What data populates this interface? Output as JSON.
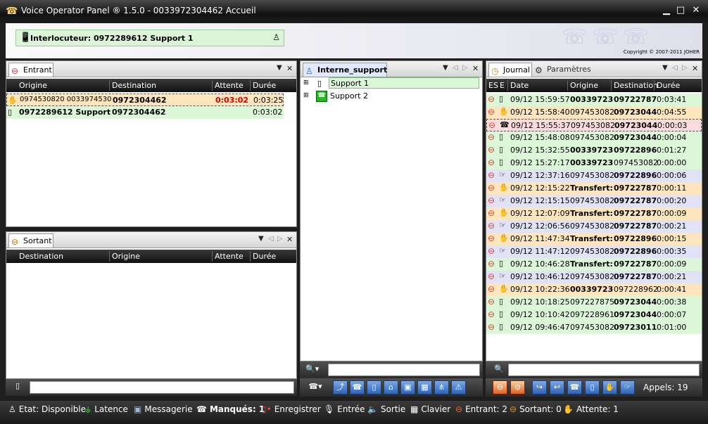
{
  "window": {
    "title": "Voice Operator Panel ® 1.5.0 - 0033972304462 Accueil"
  },
  "header": {
    "interlocutor": "Interlocuteur: 0972289612 Support 1",
    "copyright": "Copyright © 2007-2011 JOHER"
  },
  "entrant": {
    "tab": "Entrant",
    "columns": [
      "Origine",
      "Destination",
      "Attente",
      "Durée"
    ],
    "rows": [
      {
        "origine": "0974530820 0033974530",
        "destination": "0972304462",
        "attente": "0:03:02",
        "duree": "0:03:25"
      },
      {
        "origine": "0972289612 Support",
        "destination": "0972304462",
        "attente": "",
        "duree": "0:03:02"
      }
    ]
  },
  "sortant": {
    "tab": "Sortant",
    "columns": [
      "Destination",
      "Origine",
      "Attente",
      "Durée"
    ]
  },
  "interne": {
    "tab": "Interne_support",
    "items": [
      "Support 1",
      "Support 2"
    ],
    "search_value": ""
  },
  "journal": {
    "tabs": [
      "Journal",
      "Paramètres"
    ],
    "columns": [
      "ES",
      "E",
      "Date",
      "Origine",
      "Destination",
      "Durée"
    ],
    "rows": [
      {
        "date": "09/12 15:59:57",
        "origine": "00339723",
        "destination": "09722787",
        "duree": "0:03:41"
      },
      {
        "date": "09/12 15:58:40",
        "origine": "097453082",
        "destination": "09723044",
        "duree": "0:04:55"
      },
      {
        "date": "09/12 15:55:37",
        "origine": "097453082",
        "destination": "09723044",
        "duree": "0:00:03"
      },
      {
        "date": "09/12 15:48:08",
        "origine": "097453082",
        "destination": "09723044",
        "duree": "0:00:04"
      },
      {
        "date": "09/12 15:32:55",
        "origine": "00339723",
        "destination": "09722896",
        "duree": "0:01:27"
      },
      {
        "date": "09/12 15:27:17",
        "origine": "00339723",
        "destination": "097453082",
        "duree": "0:00:00"
      },
      {
        "date": "09/12 12:37:16",
        "origine": "097453082",
        "destination": "09722896",
        "duree": "0:00:06"
      },
      {
        "date": "09/12 12:15:22",
        "origine": "Transfert:",
        "destination": "09722787",
        "duree": "0:00:11"
      },
      {
        "date": "09/12 12:15:15",
        "origine": "097453082",
        "destination": "09722787",
        "duree": "0:00:20"
      },
      {
        "date": "09/12 12:07:09",
        "origine": "Transfert:",
        "destination": "09722787",
        "duree": "0:00:09"
      },
      {
        "date": "09/12 12:06:56",
        "origine": "097453082",
        "destination": "09722787",
        "duree": "0:00:21"
      },
      {
        "date": "09/12 11:47:34",
        "origine": "Transfert:",
        "destination": "09722896",
        "duree": "0:00:15"
      },
      {
        "date": "09/12 11:47:12",
        "origine": "097453082",
        "destination": "09722896",
        "duree": "0:00:35"
      },
      {
        "date": "09/12 10:46:28",
        "origine": "Transfert:",
        "destination": "09722787",
        "duree": "0:00:09"
      },
      {
        "date": "09/12 10:46:12",
        "origine": "097453082",
        "destination": "09722787",
        "duree": "0:00:21"
      },
      {
        "date": "09/12 10:22:36",
        "origine": "00339723",
        "destination": "097228962",
        "duree": "0:00:41"
      },
      {
        "date": "09/12 10:18:25",
        "origine": "097227875",
        "destination": "09723044",
        "duree": "0:00:38"
      },
      {
        "date": "09/12 10:10:42",
        "origine": "097228961",
        "destination": "09723044",
        "duree": "0:00:07"
      },
      {
        "date": "09/12 09:46:47",
        "origine": "097453082",
        "destination": "09723011",
        "duree": "0:01:00"
      }
    ],
    "appels": "Appels: 19"
  },
  "status": {
    "etat": "Etat: Disponible",
    "latence": "Latence",
    "messagerie": "Messagerie",
    "manques": "Manqués: 1",
    "enregistrer": "Enregistrer",
    "entree": "Entrée",
    "sortie": "Sortie",
    "clavier": "Clavier",
    "entrant": "Entrant: 2",
    "sortant": "Sortant: 0",
    "attente": "Attente: 1"
  }
}
